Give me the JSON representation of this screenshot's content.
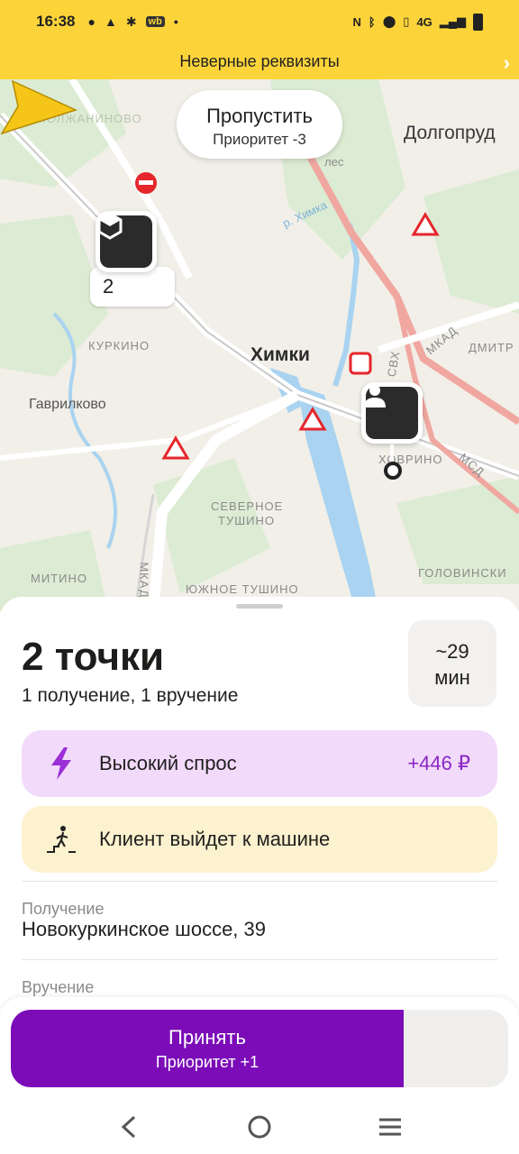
{
  "status_bar": {
    "time": "16:38",
    "left_icons": [
      "chat-icon",
      "warning-icon",
      "gear-icon",
      "wb-icon",
      "dot-icon"
    ],
    "right_text": "4G",
    "right_icons": [
      "nfc-icon",
      "bluetooth-icon",
      "location-icon",
      "vibrate-icon",
      "volte-icon",
      "signal-icon",
      "battery-icon"
    ]
  },
  "banner": {
    "text": "Неверные реквизиты",
    "chevron": "›"
  },
  "map": {
    "skip": {
      "title": "Пропустить",
      "subtitle": "Приоритет -3"
    },
    "pickup_badge": "2",
    "labels": {
      "city": "Химки",
      "city_top_right": "Долгопруд",
      "village": "Гаврилково",
      "kurkino": "КУРКИНО",
      "severnoe_tushino_1": "СЕВЕРНОЕ",
      "severnoe_tushino_2": "ТУШИНО",
      "yuzhnoe_tushino": "ЮЖНОЕ ТУШИНО",
      "mitino": "МИТИНО",
      "golovinsky": "ГОЛОВИНСКИ",
      "khovrino": "ХОВРИНО",
      "dmitrov": "ДМИТР",
      "mkad_1": "МКАД",
      "mkad_2": "МКАД",
      "msd": "МСД",
      "svh": "СВХ",
      "les": "лес",
      "khimka": "р. Химка",
      "molzhaninovo": "МОЛЖАНИНОВО"
    }
  },
  "order": {
    "title": "2 точки",
    "subtitle": "1 получение, 1 вручение",
    "eta_line1": "~29",
    "eta_line2": "мин",
    "demand_label": "Высокий спрос",
    "demand_value": "+446 ₽",
    "client_label": "Клиент выйдет к машине",
    "pickup_label": "Получение",
    "pickup_address": "Новокуркинское шоссе, 39",
    "delivery_label": "Вручение"
  },
  "action": {
    "accept_label": "Принять",
    "accept_sub": "Приоритет +1",
    "progress": 0.79
  },
  "colors": {
    "accent": "#fcd43a",
    "purple": "#7b0cb8",
    "demand_bg": "#f2dafb",
    "client_bg": "#fdf2cf"
  }
}
